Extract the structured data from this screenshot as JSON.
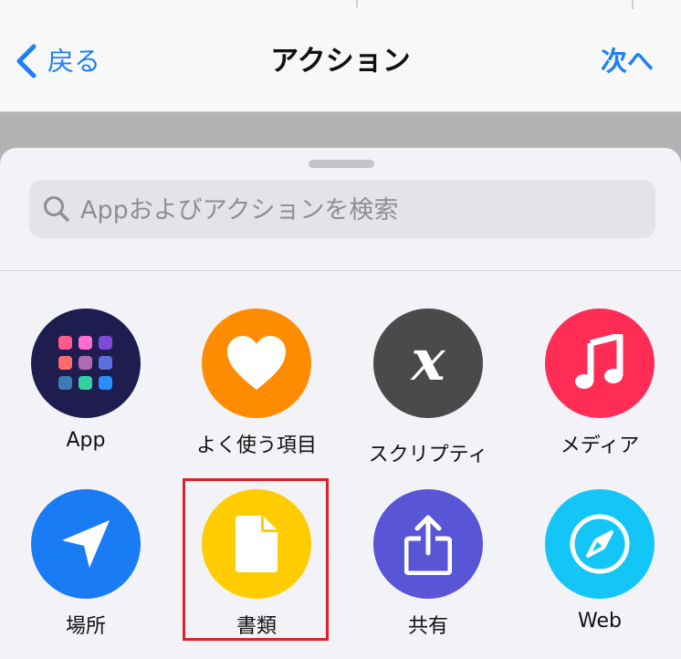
{
  "nav": {
    "back_label": "戻る",
    "title": "アクション",
    "next_label": "次へ"
  },
  "search": {
    "placeholder": "Appおよびアクションを検索"
  },
  "categories": [
    {
      "label": "App",
      "icon": "app-grid-icon",
      "color": "#1f1d4f"
    },
    {
      "label": "よく使う項目",
      "icon": "heart-icon",
      "color": "#ff8c00"
    },
    {
      "label": "スクリプティ",
      "icon": "variable-x-icon",
      "color": "#4a4a4a"
    },
    {
      "label": "メディア",
      "icon": "music-note-icon",
      "color": "#ff2d55"
    },
    {
      "label": "場所",
      "icon": "location-arrow-icon",
      "color": "#1a7cf5"
    },
    {
      "label": "書類",
      "icon": "document-icon",
      "color": "#ffcc00"
    },
    {
      "label": "共有",
      "icon": "share-icon",
      "color": "#5856d6"
    },
    {
      "label": "Web",
      "icon": "compass-icon",
      "color": "#14c6f7"
    }
  ],
  "colors": {
    "accent": "#1e7ff6",
    "highlight_border": "#e0202a"
  }
}
